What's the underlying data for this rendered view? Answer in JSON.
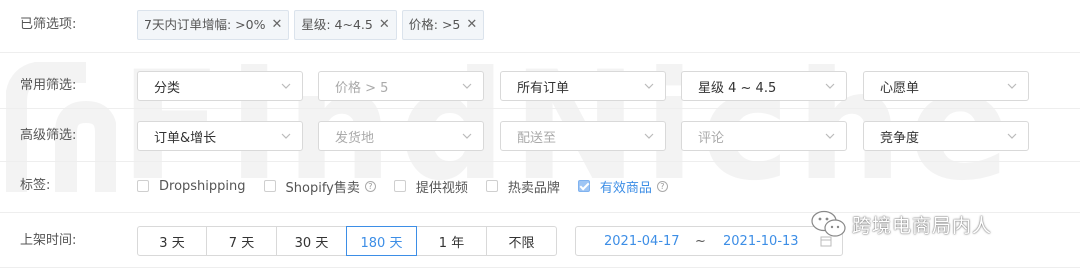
{
  "filters": {
    "label": "已筛选项:",
    "chips": [
      "7天内订单增幅: >0%",
      "星级: 4~4.5",
      "价格: >5"
    ]
  },
  "common": {
    "label": "常用筛选:",
    "selects": [
      "分类",
      "价格 > 5",
      "所有订单",
      "星级 4 ~ 4.5",
      "心愿单"
    ]
  },
  "advanced": {
    "label": "高级筛选:",
    "selects": [
      "订单&增长",
      "发货地",
      "配送至",
      "评论",
      "竞争度"
    ]
  },
  "tags": {
    "label": "标签:",
    "items": [
      "Dropshipping",
      "Shopify售卖",
      "提供视频",
      "热卖品牌",
      "有效商品"
    ],
    "checked": [
      false,
      false,
      false,
      false,
      true
    ]
  },
  "listing": {
    "label": "上架时间:",
    "options": [
      "3 天",
      "7 天",
      "30 天",
      "180 天",
      "1 年",
      "不限"
    ],
    "active_index": 3,
    "date_from": "2021-04-17",
    "date_sep": "~",
    "date_to": "2021-10-13"
  },
  "watermark": {
    "text": "FindNiche",
    "wechat_text": "跨境电商局内人"
  },
  "colors": {
    "accent": "#3d8ee6",
    "chip_bg": "#f3f6f9",
    "border": "#d9d9d9"
  }
}
